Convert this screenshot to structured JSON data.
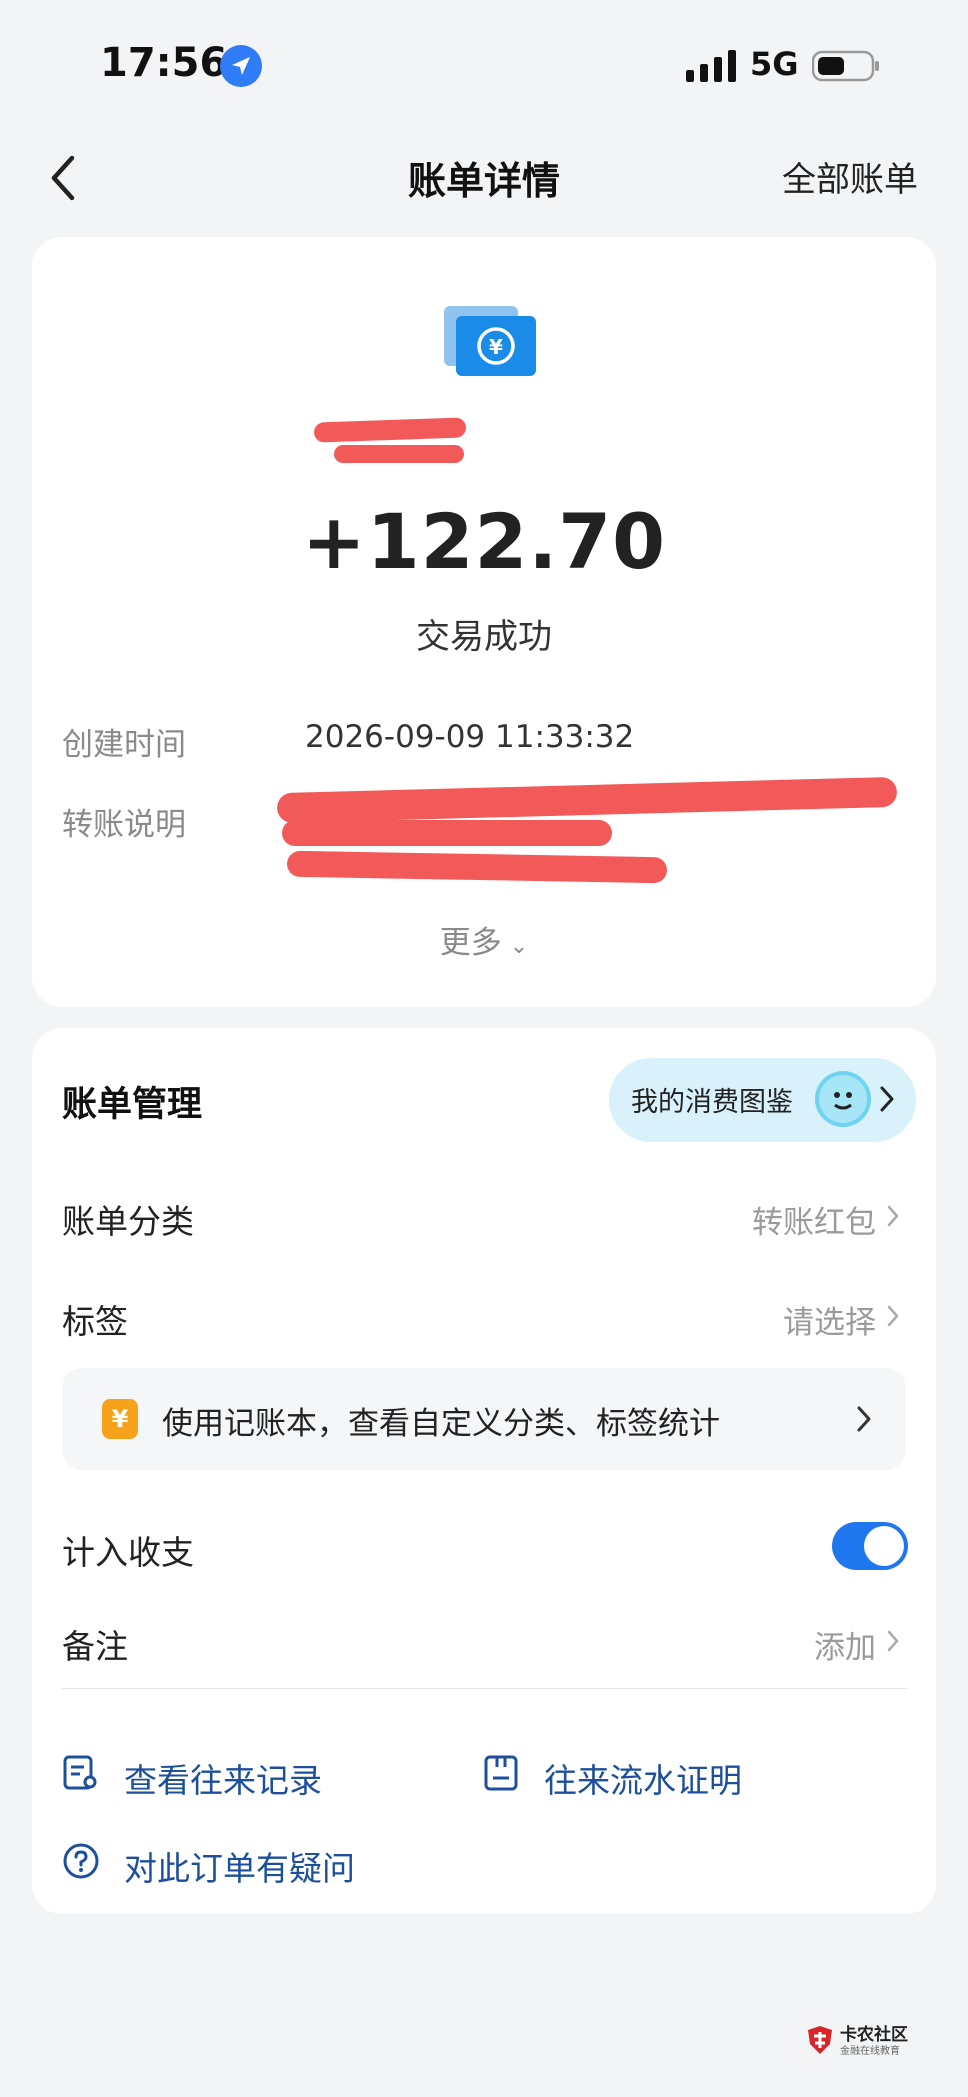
{
  "status_bar": {
    "time": "17:56",
    "network": "5G"
  },
  "nav": {
    "title": "账单详情",
    "right_action": "全部账单"
  },
  "transaction": {
    "amount": "+122.70",
    "status": "交易成功",
    "details": [
      {
        "label": "创建时间",
        "value": "2026-09-09 11:33:32"
      },
      {
        "label": "转账说明",
        "value": ""
      }
    ],
    "more_label": "更多"
  },
  "bill_management": {
    "title": "账单管理",
    "consumption_pill": "我的消费图鉴",
    "category": {
      "label": "账单分类",
      "value": "转账红包"
    },
    "tag": {
      "label": "标签",
      "value": "请选择"
    },
    "ledger_banner": {
      "icon_text": "¥",
      "text": "使用记账本，查看自定义分类、标签统计"
    },
    "include_in_stats": {
      "label": "计入收支",
      "enabled": true
    },
    "note": {
      "label": "备注",
      "value": "添加"
    },
    "links": {
      "records": "查看往来记录",
      "proof": "往来流水证明",
      "question": "对此订单有疑问"
    }
  },
  "watermark": {
    "title": "卡农社区",
    "subtitle": "金融在线教育"
  },
  "colors": {
    "accent_blue": "#1f77f0",
    "link_blue": "#1d4f9c",
    "redaction": "#f25a5a",
    "background": "#f3f4f6"
  }
}
